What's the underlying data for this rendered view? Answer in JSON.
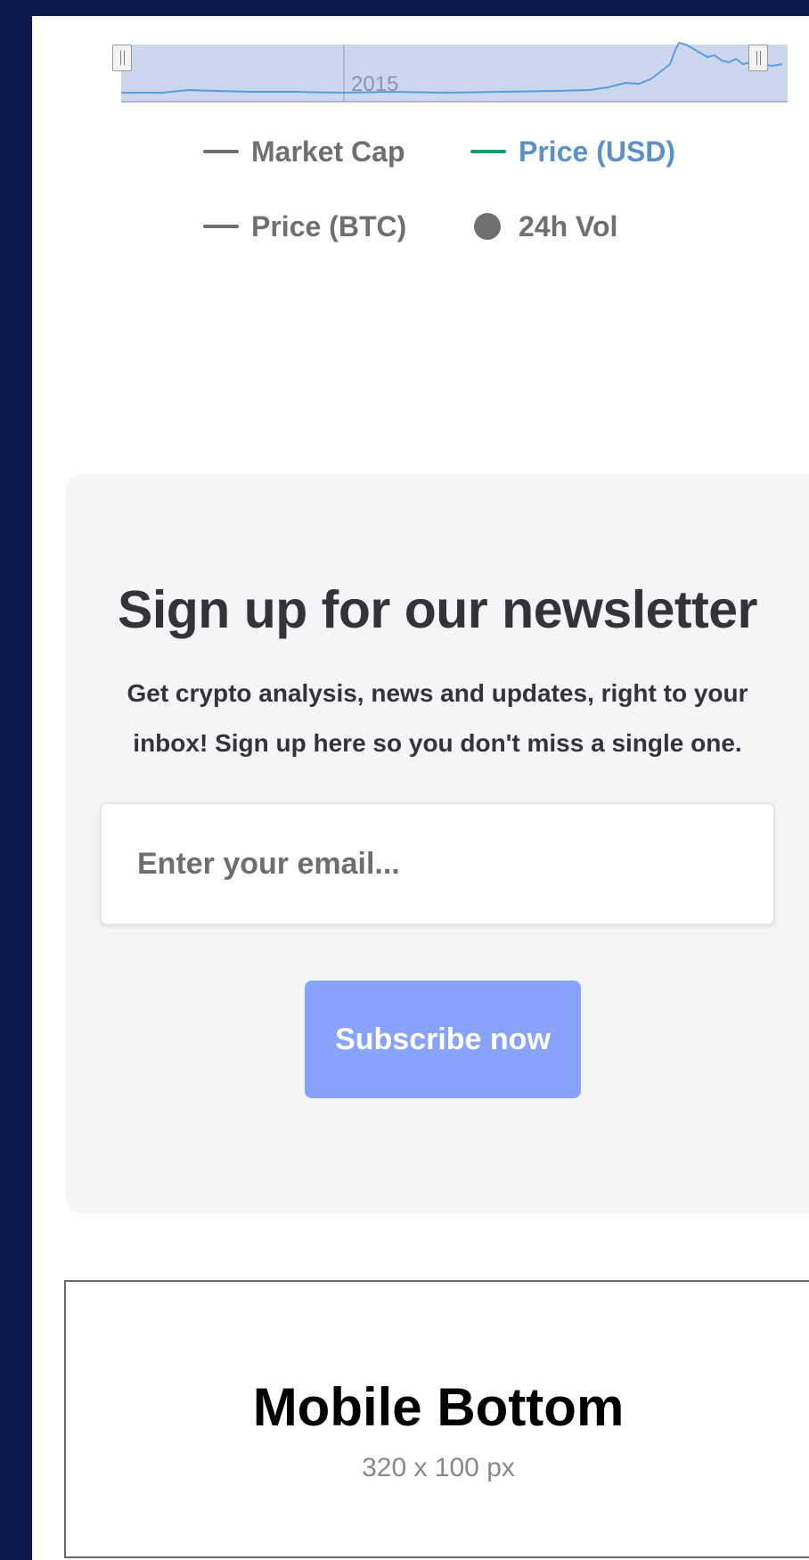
{
  "navigator": {
    "year_label": "2015"
  },
  "legend": {
    "items": [
      {
        "label": "Market Cap",
        "color": "#6f6f6f",
        "symbol": "line",
        "active": false
      },
      {
        "label": "Price (USD)",
        "color": "#1a9a6e",
        "label_color": "#5b8fc8",
        "symbol": "line",
        "active": true
      },
      {
        "label": "Price (BTC)",
        "color": "#6f6f6f",
        "symbol": "line",
        "active": false
      },
      {
        "label": "24h Vol",
        "color": "#6f6f6f",
        "symbol": "dot",
        "active": false
      }
    ]
  },
  "newsletter": {
    "title": "Sign up for our newsletter",
    "subtitle": "Get crypto analysis, news and updates, right to your inbox! Sign up here so you don't miss a single one.",
    "email_placeholder": "Enter your email...",
    "subscribe_label": "Subscribe now",
    "button_color": "#87a3fb"
  },
  "ad": {
    "title": "Mobile Bottom",
    "size_text": "320 x 100 px"
  },
  "colors": {
    "page_background": "#0b1a4a",
    "card_background": "#f4f5f7",
    "navigator_fill": "#ccd7ee",
    "series_line": "#5b9be0"
  }
}
